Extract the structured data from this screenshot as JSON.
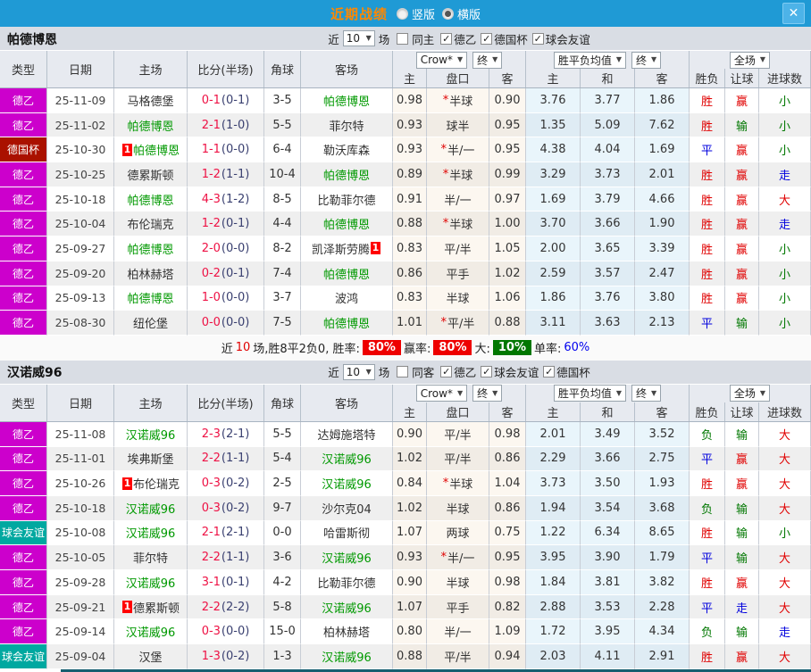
{
  "titlebar": {
    "title": "近期战绩",
    "radio_vertical": "竖版",
    "radio_horizontal": "横版",
    "selected": "横版",
    "close_icon": "✕"
  },
  "colors": {
    "titlebar_bg": "#1f9ad5",
    "title_text": "#ff8800",
    "close_bg": "#4db3e8",
    "type_德乙": "#cc00cc",
    "type_德国杯": "#aa1100",
    "type_球会友谊": "#00a8a0",
    "self_team": "#009900",
    "score_ft": "#ee1144",
    "score_ht": "#3a4070",
    "win": "#e00000",
    "draw": "#0000dd",
    "loss": "#007700",
    "chip_red": "#ee0000",
    "chip_green": "#007700",
    "rate_blue": "#0000ee"
  },
  "filter_labels": {
    "near": "近",
    "count": "10",
    "games": "场"
  },
  "table": {
    "main_columns": [
      "类型",
      "日期",
      "主场",
      "比分(半场)",
      "角球",
      "客场"
    ],
    "sub_columns": [
      "主",
      "盘口",
      "客",
      "主",
      "和",
      "客",
      "胜负",
      "让球",
      "进球数"
    ],
    "selects": {
      "company": "Crow*",
      "final1": "终",
      "avg": "胜平负均值",
      "final2": "终",
      "scope": "全场"
    }
  },
  "sections": [
    {
      "team": "帕德博恩",
      "same_label": "同主",
      "same_checked": false,
      "leagues": [
        {
          "label": "德乙",
          "checked": true
        },
        {
          "label": "德国杯",
          "checked": true
        },
        {
          "label": "球会友谊",
          "checked": true
        }
      ],
      "rows": [
        {
          "type": "德乙",
          "date": "25-11-09",
          "home": "马格德堡",
          "home_self": false,
          "home_badge": "",
          "score": "0-1",
          "half": "(0-1)",
          "corner": "3-5",
          "away": "帕德博恩",
          "away_self": true,
          "away_badge": "",
          "odds_home": "0.98",
          "star": true,
          "handicap": "半球",
          "odds_away": "0.90",
          "avg_home": "3.76",
          "avg_draw": "3.77",
          "avg_away": "1.86",
          "result": "胜",
          "handicap_result": "赢",
          "goals_result": "小"
        },
        {
          "type": "德乙",
          "date": "25-11-02",
          "home": "帕德博恩",
          "home_self": true,
          "home_badge": "",
          "score": "2-1",
          "half": "(1-0)",
          "corner": "5-5",
          "away": "菲尔特",
          "away_self": false,
          "away_badge": "",
          "odds_home": "0.93",
          "star": false,
          "handicap": "球半",
          "odds_away": "0.95",
          "avg_home": "1.35",
          "avg_draw": "5.09",
          "avg_away": "7.62",
          "result": "胜",
          "handicap_result": "输",
          "goals_result": "小"
        },
        {
          "type": "德国杯",
          "date": "25-10-30",
          "home": "帕德博恩",
          "home_self": true,
          "home_badge": "1",
          "score": "1-1",
          "half": "(0-0)",
          "corner": "6-4",
          "away": "勒沃库森",
          "away_self": false,
          "away_badge": "",
          "odds_home": "0.93",
          "star": true,
          "handicap": "半/一",
          "odds_away": "0.95",
          "avg_home": "4.38",
          "avg_draw": "4.04",
          "avg_away": "1.69",
          "result": "平",
          "handicap_result": "赢",
          "goals_result": "小"
        },
        {
          "type": "德乙",
          "date": "25-10-25",
          "home": "德累斯顿",
          "home_self": false,
          "home_badge": "",
          "score": "1-2",
          "half": "(1-1)",
          "corner": "10-4",
          "away": "帕德博恩",
          "away_self": true,
          "away_badge": "",
          "odds_home": "0.89",
          "star": true,
          "handicap": "半球",
          "odds_away": "0.99",
          "avg_home": "3.29",
          "avg_draw": "3.73",
          "avg_away": "2.01",
          "result": "胜",
          "handicap_result": "赢",
          "goals_result": "走"
        },
        {
          "type": "德乙",
          "date": "25-10-18",
          "home": "帕德博恩",
          "home_self": true,
          "home_badge": "",
          "score": "4-3",
          "half": "(1-2)",
          "corner": "8-5",
          "away": "比勒菲尔德",
          "away_self": false,
          "away_badge": "",
          "odds_home": "0.91",
          "star": false,
          "handicap": "半/一",
          "odds_away": "0.97",
          "avg_home": "1.69",
          "avg_draw": "3.79",
          "avg_away": "4.66",
          "result": "胜",
          "handicap_result": "赢",
          "goals_result": "大"
        },
        {
          "type": "德乙",
          "date": "25-10-04",
          "home": "布伦瑞克",
          "home_self": false,
          "home_badge": "",
          "score": "1-2",
          "half": "(0-1)",
          "corner": "4-4",
          "away": "帕德博恩",
          "away_self": true,
          "away_badge": "",
          "odds_home": "0.88",
          "star": true,
          "handicap": "半球",
          "odds_away": "1.00",
          "avg_home": "3.70",
          "avg_draw": "3.66",
          "avg_away": "1.90",
          "result": "胜",
          "handicap_result": "赢",
          "goals_result": "走"
        },
        {
          "type": "德乙",
          "date": "25-09-27",
          "home": "帕德博恩",
          "home_self": true,
          "home_badge": "",
          "score": "2-0",
          "half": "(0-0)",
          "corner": "8-2",
          "away": "凯泽斯劳腾",
          "away_self": false,
          "away_badge": "1",
          "odds_home": "0.83",
          "star": false,
          "handicap": "平/半",
          "odds_away": "1.05",
          "avg_home": "2.00",
          "avg_draw": "3.65",
          "avg_away": "3.39",
          "result": "胜",
          "handicap_result": "赢",
          "goals_result": "小"
        },
        {
          "type": "德乙",
          "date": "25-09-20",
          "home": "柏林赫塔",
          "home_self": false,
          "home_badge": "",
          "score": "0-2",
          "half": "(0-1)",
          "corner": "7-4",
          "away": "帕德博恩",
          "away_self": true,
          "away_badge": "",
          "odds_home": "0.86",
          "star": false,
          "handicap": "平手",
          "odds_away": "1.02",
          "avg_home": "2.59",
          "avg_draw": "3.57",
          "avg_away": "2.47",
          "result": "胜",
          "handicap_result": "赢",
          "goals_result": "小"
        },
        {
          "type": "德乙",
          "date": "25-09-13",
          "home": "帕德博恩",
          "home_self": true,
          "home_badge": "",
          "score": "1-0",
          "half": "(0-0)",
          "corner": "3-7",
          "away": "波鸿",
          "away_self": false,
          "away_badge": "",
          "odds_home": "0.83",
          "star": false,
          "handicap": "半球",
          "odds_away": "1.06",
          "avg_home": "1.86",
          "avg_draw": "3.76",
          "avg_away": "3.80",
          "result": "胜",
          "handicap_result": "赢",
          "goals_result": "小"
        },
        {
          "type": "德乙",
          "date": "25-08-30",
          "home": "纽伦堡",
          "home_self": false,
          "home_badge": "",
          "score": "0-0",
          "half": "(0-0)",
          "corner": "7-5",
          "away": "帕德博恩",
          "away_self": true,
          "away_badge": "",
          "odds_home": "1.01",
          "star": true,
          "handicap": "平/半",
          "odds_away": "0.88",
          "avg_home": "3.11",
          "avg_draw": "3.63",
          "avg_away": "2.13",
          "result": "平",
          "handicap_result": "输",
          "goals_result": "小"
        }
      ],
      "summary": {
        "near": "近",
        "count": "10",
        "text": "场,胜8平2负0, 胜率:",
        "rate1": "80%",
        "label2": "赢率:",
        "rate2": "80%",
        "label3": "大:",
        "rate3": "10%",
        "label4": "单率:",
        "rate4": "60%"
      }
    },
    {
      "team": "汉诺威96",
      "same_label": "同客",
      "same_checked": false,
      "leagues": [
        {
          "label": "德乙",
          "checked": true
        },
        {
          "label": "球会友谊",
          "checked": true
        },
        {
          "label": "德国杯",
          "checked": true
        }
      ],
      "rows": [
        {
          "type": "德乙",
          "date": "25-11-08",
          "home": "汉诺威96",
          "home_self": true,
          "home_badge": "",
          "score": "2-3",
          "half": "(2-1)",
          "corner": "5-5",
          "away": "达姆施塔特",
          "away_self": false,
          "away_badge": "",
          "odds_home": "0.90",
          "star": false,
          "handicap": "平/半",
          "odds_away": "0.98",
          "avg_home": "2.01",
          "avg_draw": "3.49",
          "avg_away": "3.52",
          "result": "负",
          "handicap_result": "输",
          "goals_result": "大"
        },
        {
          "type": "德乙",
          "date": "25-11-01",
          "home": "埃弗斯堡",
          "home_self": false,
          "home_badge": "",
          "score": "2-2",
          "half": "(1-1)",
          "corner": "5-4",
          "away": "汉诺威96",
          "away_self": true,
          "away_badge": "",
          "odds_home": "1.02",
          "star": false,
          "handicap": "平/半",
          "odds_away": "0.86",
          "avg_home": "2.29",
          "avg_draw": "3.66",
          "avg_away": "2.75",
          "result": "平",
          "handicap_result": "赢",
          "goals_result": "大"
        },
        {
          "type": "德乙",
          "date": "25-10-26",
          "home": "布伦瑞克",
          "home_self": false,
          "home_badge": "1",
          "score": "0-3",
          "half": "(0-2)",
          "corner": "2-5",
          "away": "汉诺威96",
          "away_self": true,
          "away_badge": "",
          "odds_home": "0.84",
          "star": true,
          "handicap": "半球",
          "odds_away": "1.04",
          "avg_home": "3.73",
          "avg_draw": "3.50",
          "avg_away": "1.93",
          "result": "胜",
          "handicap_result": "赢",
          "goals_result": "大"
        },
        {
          "type": "德乙",
          "date": "25-10-18",
          "home": "汉诺威96",
          "home_self": true,
          "home_badge": "",
          "score": "0-3",
          "half": "(0-2)",
          "corner": "9-7",
          "away": "沙尔克04",
          "away_self": false,
          "away_badge": "",
          "odds_home": "1.02",
          "star": false,
          "handicap": "半球",
          "odds_away": "0.86",
          "avg_home": "1.94",
          "avg_draw": "3.54",
          "avg_away": "3.68",
          "result": "负",
          "handicap_result": "输",
          "goals_result": "大"
        },
        {
          "type": "球会友谊",
          "date": "25-10-08",
          "home": "汉诺威96",
          "home_self": true,
          "home_badge": "",
          "score": "2-1",
          "half": "(2-1)",
          "corner": "0-0",
          "away": "哈雷斯彻",
          "away_self": false,
          "away_badge": "",
          "odds_home": "1.07",
          "star": false,
          "handicap": "两球",
          "odds_away": "0.75",
          "avg_home": "1.22",
          "avg_draw": "6.34",
          "avg_away": "8.65",
          "result": "胜",
          "handicap_result": "输",
          "goals_result": "小"
        },
        {
          "type": "德乙",
          "date": "25-10-05",
          "home": "菲尔特",
          "home_self": false,
          "home_badge": "",
          "score": "2-2",
          "half": "(1-1)",
          "corner": "3-6",
          "away": "汉诺威96",
          "away_self": true,
          "away_badge": "",
          "odds_home": "0.93",
          "star": true,
          "handicap": "半/一",
          "odds_away": "0.95",
          "avg_home": "3.95",
          "avg_draw": "3.90",
          "avg_away": "1.79",
          "result": "平",
          "handicap_result": "输",
          "goals_result": "大"
        },
        {
          "type": "德乙",
          "date": "25-09-28",
          "home": "汉诺威96",
          "home_self": true,
          "home_badge": "",
          "score": "3-1",
          "half": "(0-1)",
          "corner": "4-2",
          "away": "比勒菲尔德",
          "away_self": false,
          "away_badge": "",
          "odds_home": "0.90",
          "star": false,
          "handicap": "半球",
          "odds_away": "0.98",
          "avg_home": "1.84",
          "avg_draw": "3.81",
          "avg_away": "3.82",
          "result": "胜",
          "handicap_result": "赢",
          "goals_result": "大"
        },
        {
          "type": "德乙",
          "date": "25-09-21",
          "home": "德累斯顿",
          "home_self": false,
          "home_badge": "1",
          "score": "2-2",
          "half": "(2-2)",
          "corner": "5-8",
          "away": "汉诺威96",
          "away_self": true,
          "away_badge": "",
          "odds_home": "1.07",
          "star": false,
          "handicap": "平手",
          "odds_away": "0.82",
          "avg_home": "2.88",
          "avg_draw": "3.53",
          "avg_away": "2.28",
          "result": "平",
          "handicap_result": "走",
          "goals_result": "大"
        },
        {
          "type": "德乙",
          "date": "25-09-14",
          "home": "汉诺威96",
          "home_self": true,
          "home_badge": "",
          "score": "0-3",
          "half": "(0-0)",
          "corner": "15-0",
          "away": "柏林赫塔",
          "away_self": false,
          "away_badge": "",
          "odds_home": "0.80",
          "star": false,
          "handicap": "半/一",
          "odds_away": "1.09",
          "avg_home": "1.72",
          "avg_draw": "3.95",
          "avg_away": "4.34",
          "result": "负",
          "handicap_result": "输",
          "goals_result": "走"
        },
        {
          "type": "球会友谊",
          "date": "25-09-04",
          "home": "汉堡",
          "home_self": false,
          "home_badge": "",
          "score": "1-3",
          "half": "(0-2)",
          "corner": "1-3",
          "away": "汉诺威96",
          "away_self": true,
          "away_badge": "",
          "odds_home": "0.88",
          "star": false,
          "handicap": "平/半",
          "odds_away": "0.94",
          "avg_home": "2.03",
          "avg_draw": "4.11",
          "avg_away": "2.91",
          "result": "胜",
          "handicap_result": "赢",
          "goals_result": "大"
        }
      ],
      "summary": null
    }
  ]
}
